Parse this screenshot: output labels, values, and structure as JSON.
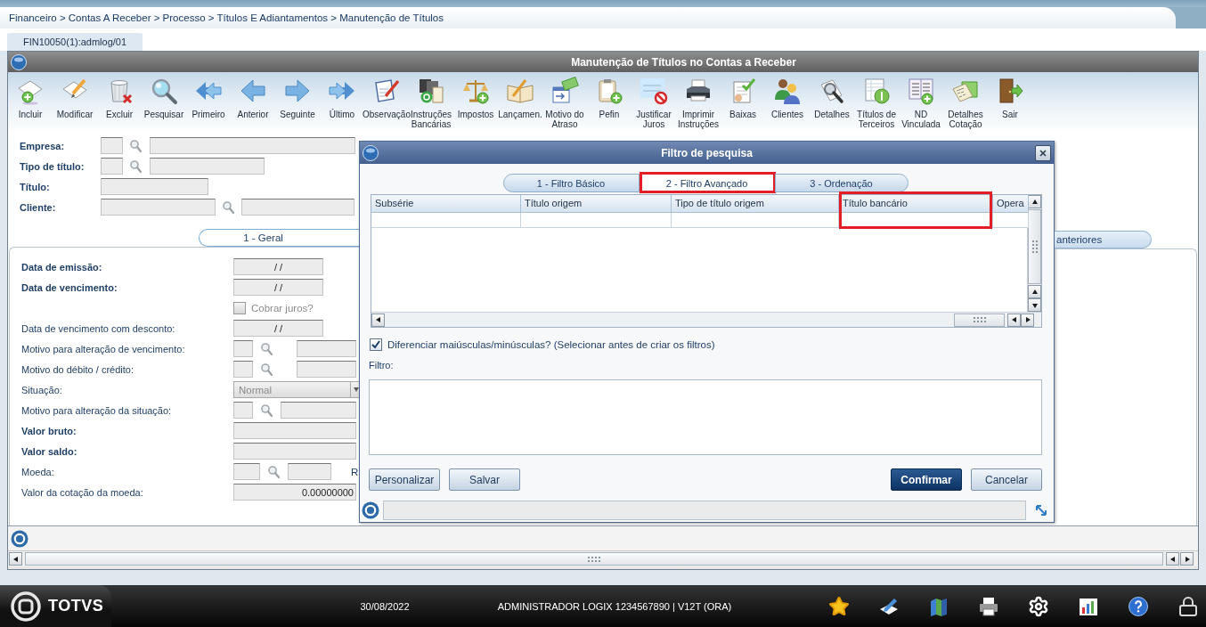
{
  "breadcrumb": "Financeiro > Contas A Receber > Processo > Títulos E Adiantamentos > Manutenção de Títulos",
  "session_tab": {
    "label": "FIN10050(1):admlog/01"
  },
  "window": {
    "title": "Manutenção de Títulos no Contas a Receber"
  },
  "toolbar": [
    {
      "label": "Incluir"
    },
    {
      "label": "Modificar"
    },
    {
      "label": "Excluir"
    },
    {
      "label": "Pesquisar"
    },
    {
      "label": "Primeiro"
    },
    {
      "label": "Anterior"
    },
    {
      "label": "Seguinte"
    },
    {
      "label": "Último"
    },
    {
      "label": "Observação"
    },
    {
      "label": "Instruções Bancárias"
    },
    {
      "label": "Impostos"
    },
    {
      "label": "Lançamen."
    },
    {
      "label": "Motivo do Atraso"
    },
    {
      "label": "Pefin"
    },
    {
      "label": "Justificar Juros"
    },
    {
      "label": "Imprimir Instruções"
    },
    {
      "label": "Baixas"
    },
    {
      "label": "Clientes"
    },
    {
      "label": "Detalhes"
    },
    {
      "label": "Títulos de Terceiros"
    },
    {
      "label": "ND Vinculada"
    },
    {
      "label": "Detalhes Cotação"
    },
    {
      "label": "Sair"
    }
  ],
  "form": {
    "header_rows": [
      {
        "kind": "lookup",
        "label": "Empresa:",
        "required": true
      },
      {
        "kind": "lookup",
        "label": "Tipo de título:",
        "required": true
      },
      {
        "kind": "text",
        "label": "Título:",
        "required": true
      },
      {
        "kind": "lookup",
        "label": "Cliente:",
        "required": true
      }
    ],
    "tabs": [
      {
        "label": "1 - Geral",
        "selected": true
      },
      {
        "label": "anteriores",
        "selected": false
      }
    ],
    "panel_rows": [
      {
        "kind": "date",
        "label": "Data de emissão:",
        "required": true,
        "value": "/ /"
      },
      {
        "kind": "date",
        "label": "Data de vencimento:",
        "required": true,
        "value": "/ /"
      },
      {
        "kind": "checkbox",
        "label": "Cobrar juros?",
        "checked": false,
        "disabled": true
      },
      {
        "kind": "date",
        "label": "Data de vencimento com desconto:",
        "required": false,
        "value": "/ /"
      },
      {
        "kind": "lookup",
        "label": "Motivo para alteração de vencimento:",
        "required": false
      },
      {
        "kind": "lookup",
        "label": "Motivo do débito / crédito:",
        "required": false
      },
      {
        "kind": "select",
        "label": "Situação:",
        "required": false,
        "value": "Normal",
        "disabled": true
      },
      {
        "kind": "lookup",
        "label": "Motivo para alteração da situação:",
        "required": false
      },
      {
        "kind": "amount",
        "label": "Valor bruto:",
        "required": true
      },
      {
        "kind": "amount",
        "label": "Valor saldo:",
        "required": true
      },
      {
        "kind": "currency",
        "label": "Moeda:",
        "required": false,
        "suffix": "R"
      },
      {
        "kind": "amount",
        "label": "Valor da cotação da moeda:",
        "required": false,
        "value": "0.00000000"
      }
    ]
  },
  "filter_dialog": {
    "title": "Filtro de pesquisa",
    "tabs": [
      {
        "label": "1 - Filtro Básico",
        "selected": false,
        "highlighted": false
      },
      {
        "label": "2 - Filtro Avançado",
        "selected": true,
        "highlighted": true
      },
      {
        "label": "3 - Ordenação",
        "selected": false,
        "highlighted": false
      }
    ],
    "grid": {
      "columns": [
        {
          "label": "Subsérie",
          "highlighted": false
        },
        {
          "label": "Título origem",
          "highlighted": false
        },
        {
          "label": "Tipo de título origem",
          "highlighted": false
        },
        {
          "label": "Título bancário",
          "highlighted": true
        },
        {
          "label": "Opera",
          "highlighted": false
        }
      ]
    },
    "case_sensitive": {
      "label": "Diferenciar maiúsculas/minúsculas? (Selecionar antes de criar os filtros)",
      "checked": true
    },
    "filter_label": "Filtro:",
    "buttons_left": [
      {
        "label": "Personalizar",
        "primary": false
      },
      {
        "label": "Salvar",
        "primary": false
      }
    ],
    "buttons_right": [
      {
        "label": "Confirmar",
        "primary": true
      },
      {
        "label": "Cancelar",
        "primary": false
      }
    ]
  },
  "taskbar": {
    "brand": "TOTVS",
    "date": "30/08/2022",
    "session": "ADMINISTRADOR LOGIX 1234567890 | V12T (ORA)"
  }
}
